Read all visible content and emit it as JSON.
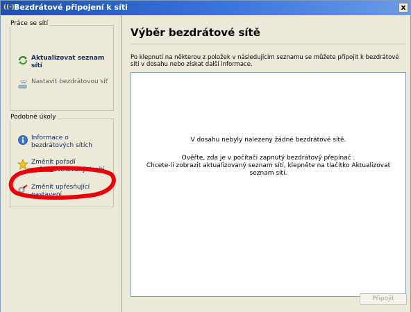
{
  "window": {
    "title": "Bezdrátové připojení k síti",
    "close_glyph": "x"
  },
  "left": {
    "group1": {
      "label": "Práce se sítí",
      "items": [
        {
          "label": "Aktualizovat seznam sítí",
          "icon": "refresh-icon"
        },
        {
          "label": "Nastavit bezdrátovou síť",
          "icon": "wireless-setup-icon"
        }
      ]
    },
    "group2": {
      "label": "Podobné úkoly",
      "items": [
        {
          "label": "Informace o\nbezdrátových sítích",
          "icon": "info-icon"
        },
        {
          "label": "Změnit pořadí\nupřednostňovaných sítí",
          "icon": "star-icon"
        },
        {
          "label": "Změnit upřesňující\nnastavení",
          "icon": "settings-icon"
        }
      ]
    }
  },
  "main": {
    "heading": "Výběr bezdrátové sítě",
    "instructions": "Po klepnutí na některou z položek v následujícím seznamu se můžete připojit k bezdrátové síti v dosahu nebo získat další informace.",
    "list": {
      "empty_message": "V dosahu nebyly nalezeny žádné bezdrátové sítě.",
      "hint_line1": "Ověřte, zda je v počítači zapnutý bezdrátový přepínač .",
      "hint_line2": "Chcete-li zobrazit aktualizovaný seznam sítí, klepněte na tlačítko Aktualizovat seznam sítí."
    },
    "connect_button": "Připojit"
  },
  "colors": {
    "titlebar": "#3b74dd",
    "annotation": "#e8000b"
  }
}
